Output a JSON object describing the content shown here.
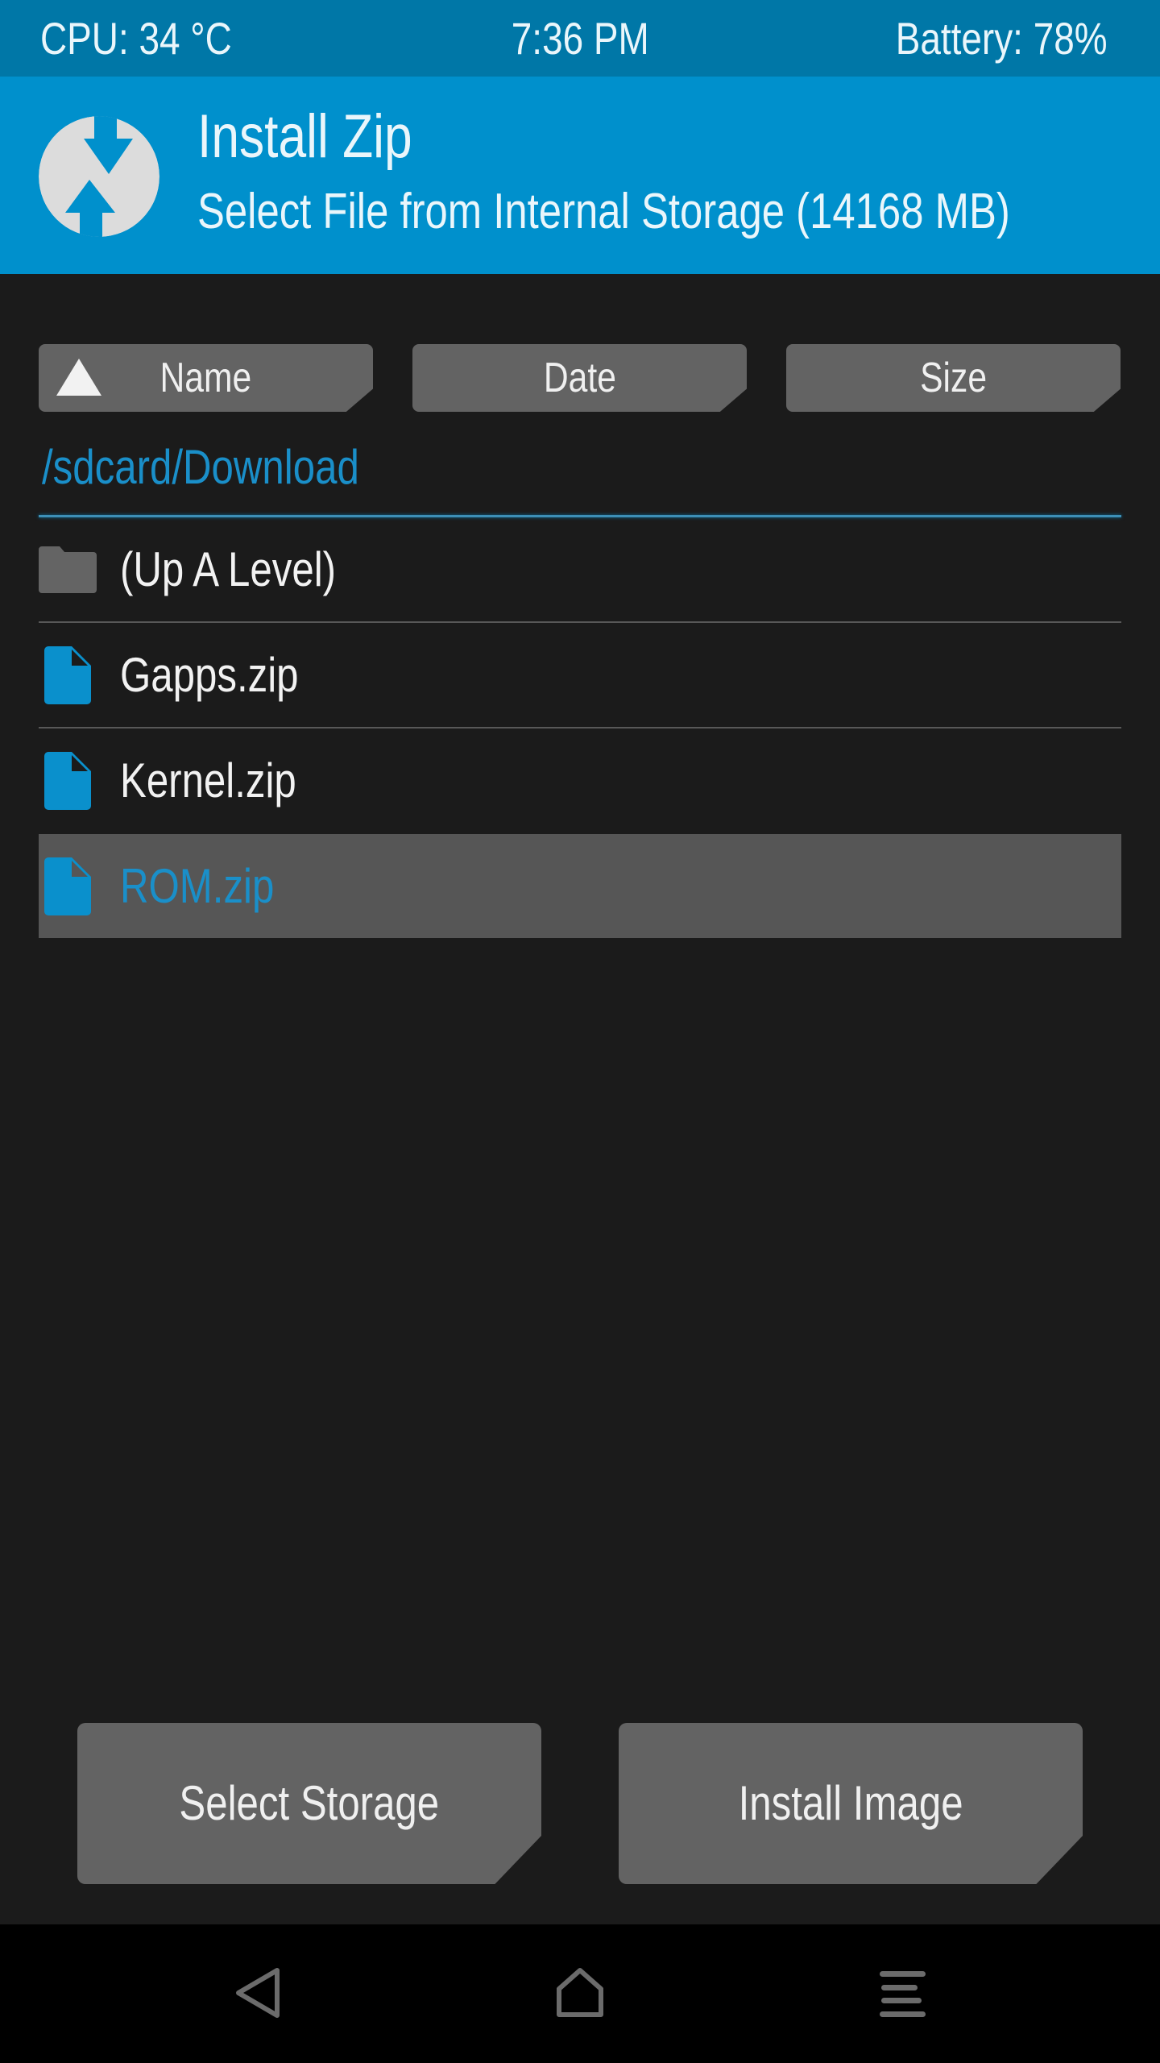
{
  "status_bar": {
    "cpu": "CPU: 34 °C",
    "time": "7:36 PM",
    "battery": "Battery: 78%"
  },
  "header": {
    "logo_icon": "twrp-logo-icon",
    "title": "Install Zip",
    "subtitle": "Select File from Internal Storage (14168 MB)"
  },
  "sort": {
    "buttons": [
      {
        "label": "Name",
        "active": true,
        "direction": "ascending"
      },
      {
        "label": "Date",
        "active": false
      },
      {
        "label": "Size",
        "active": false
      }
    ]
  },
  "browser": {
    "current_path": "/sdcard/Download",
    "items": [
      {
        "name": "(Up A Level)",
        "type": "folder",
        "icon": "folder-icon",
        "selected": false
      },
      {
        "name": "Gapps.zip",
        "type": "file",
        "icon": "file-icon",
        "selected": false
      },
      {
        "name": "Kernel.zip",
        "type": "file",
        "icon": "file-icon",
        "selected": false
      },
      {
        "name": "ROM.zip",
        "type": "file",
        "icon": "file-icon",
        "selected": true
      }
    ]
  },
  "actions": {
    "select_storage": "Select Storage",
    "install_image": "Install Image"
  },
  "navbar": {
    "back_icon": "back-icon",
    "home_icon": "home-icon",
    "menu_icon": "menu-icon"
  },
  "colors": {
    "accent": "#0090cc",
    "status_bar": "#0077a7",
    "background": "#1b1b1b",
    "button": "#636363",
    "selected_row": "#565656",
    "selected_text": "#1a8fc9"
  }
}
